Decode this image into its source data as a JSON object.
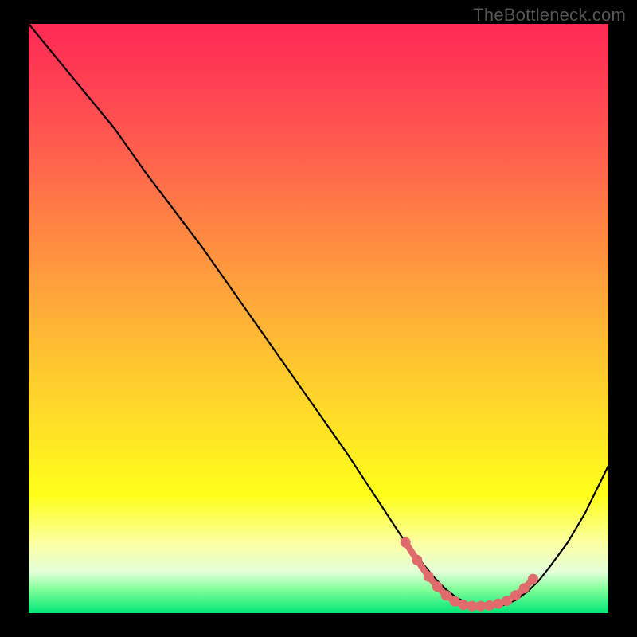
{
  "watermark": "TheBottleneck.com",
  "chart_data": {
    "type": "line",
    "title": "",
    "xlabel": "",
    "ylabel": "",
    "xlim": [
      0,
      100
    ],
    "ylim": [
      0,
      100
    ],
    "series": [
      {
        "name": "curve",
        "x": [
          0,
          5,
          10,
          15,
          20,
          25,
          30,
          35,
          40,
          45,
          50,
          55,
          60,
          65,
          70,
          72,
          74,
          76,
          78,
          80,
          82,
          84,
          86,
          88,
          90,
          93,
          96,
          100
        ],
        "values": [
          100,
          94,
          88,
          82,
          75,
          68.5,
          62,
          55,
          48,
          41,
          34,
          27,
          19.5,
          12,
          6,
          4,
          2.5,
          1.6,
          1.2,
          1.2,
          1.4,
          2.2,
          3.6,
          5.5,
          8,
          12,
          17,
          25
        ]
      }
    ],
    "flat_zone": {
      "color": "#e06a6c",
      "x": [
        65,
        67,
        69,
        70.5,
        72,
        73.5,
        75,
        76.5,
        78,
        79.5,
        81,
        82.5,
        84,
        85.5,
        87
      ],
      "values": [
        12,
        9,
        6.2,
        4.5,
        3,
        2,
        1.4,
        1.2,
        1.2,
        1.3,
        1.6,
        2.1,
        3,
        4.2,
        5.8
      ]
    },
    "gradient_stops": [
      {
        "pos": 0,
        "color": "#ff2a54"
      },
      {
        "pos": 20,
        "color": "#ff5a4e"
      },
      {
        "pos": 46,
        "color": "#ffa53a"
      },
      {
        "pos": 70,
        "color": "#ffe524"
      },
      {
        "pos": 88,
        "color": "#fbffa0"
      },
      {
        "pos": 96,
        "color": "#82ff99"
      },
      {
        "pos": 100,
        "color": "#00e676"
      }
    ]
  }
}
